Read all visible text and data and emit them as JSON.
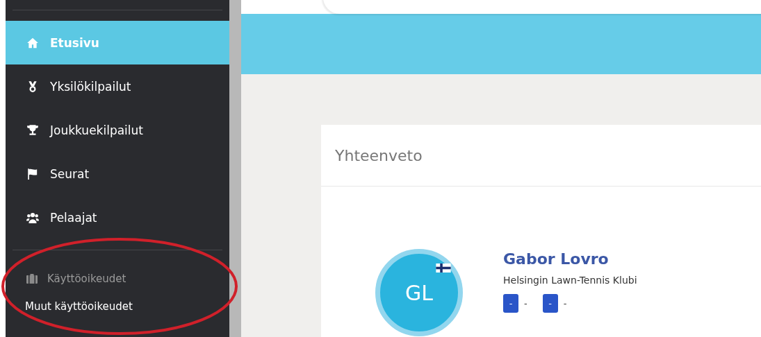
{
  "sidebar": {
    "items": [
      {
        "label": "Etusivu",
        "selected": true
      },
      {
        "label": "Yksilökilpailut",
        "selected": false
      },
      {
        "label": "Joukkuekilpailut",
        "selected": false
      },
      {
        "label": "Seurat",
        "selected": false
      },
      {
        "label": "Pelaajat",
        "selected": false
      }
    ],
    "section": {
      "label": "Käyttöoikeudet",
      "items": [
        {
          "label": "Muut käyttöoikeudet",
          "selected": false
        }
      ]
    }
  },
  "annotation": {
    "kind": "ellipse",
    "color": "#d0202a"
  },
  "summary": {
    "title": "Yhteenveto",
    "player": {
      "initials": "GL",
      "name": "Gabor Lovro",
      "club": "Helsingin Lawn-Tennis Klubi",
      "ratings": [
        {
          "badge": "-",
          "value": "-"
        },
        {
          "badge": "-",
          "value": "-"
        }
      ]
    }
  }
}
